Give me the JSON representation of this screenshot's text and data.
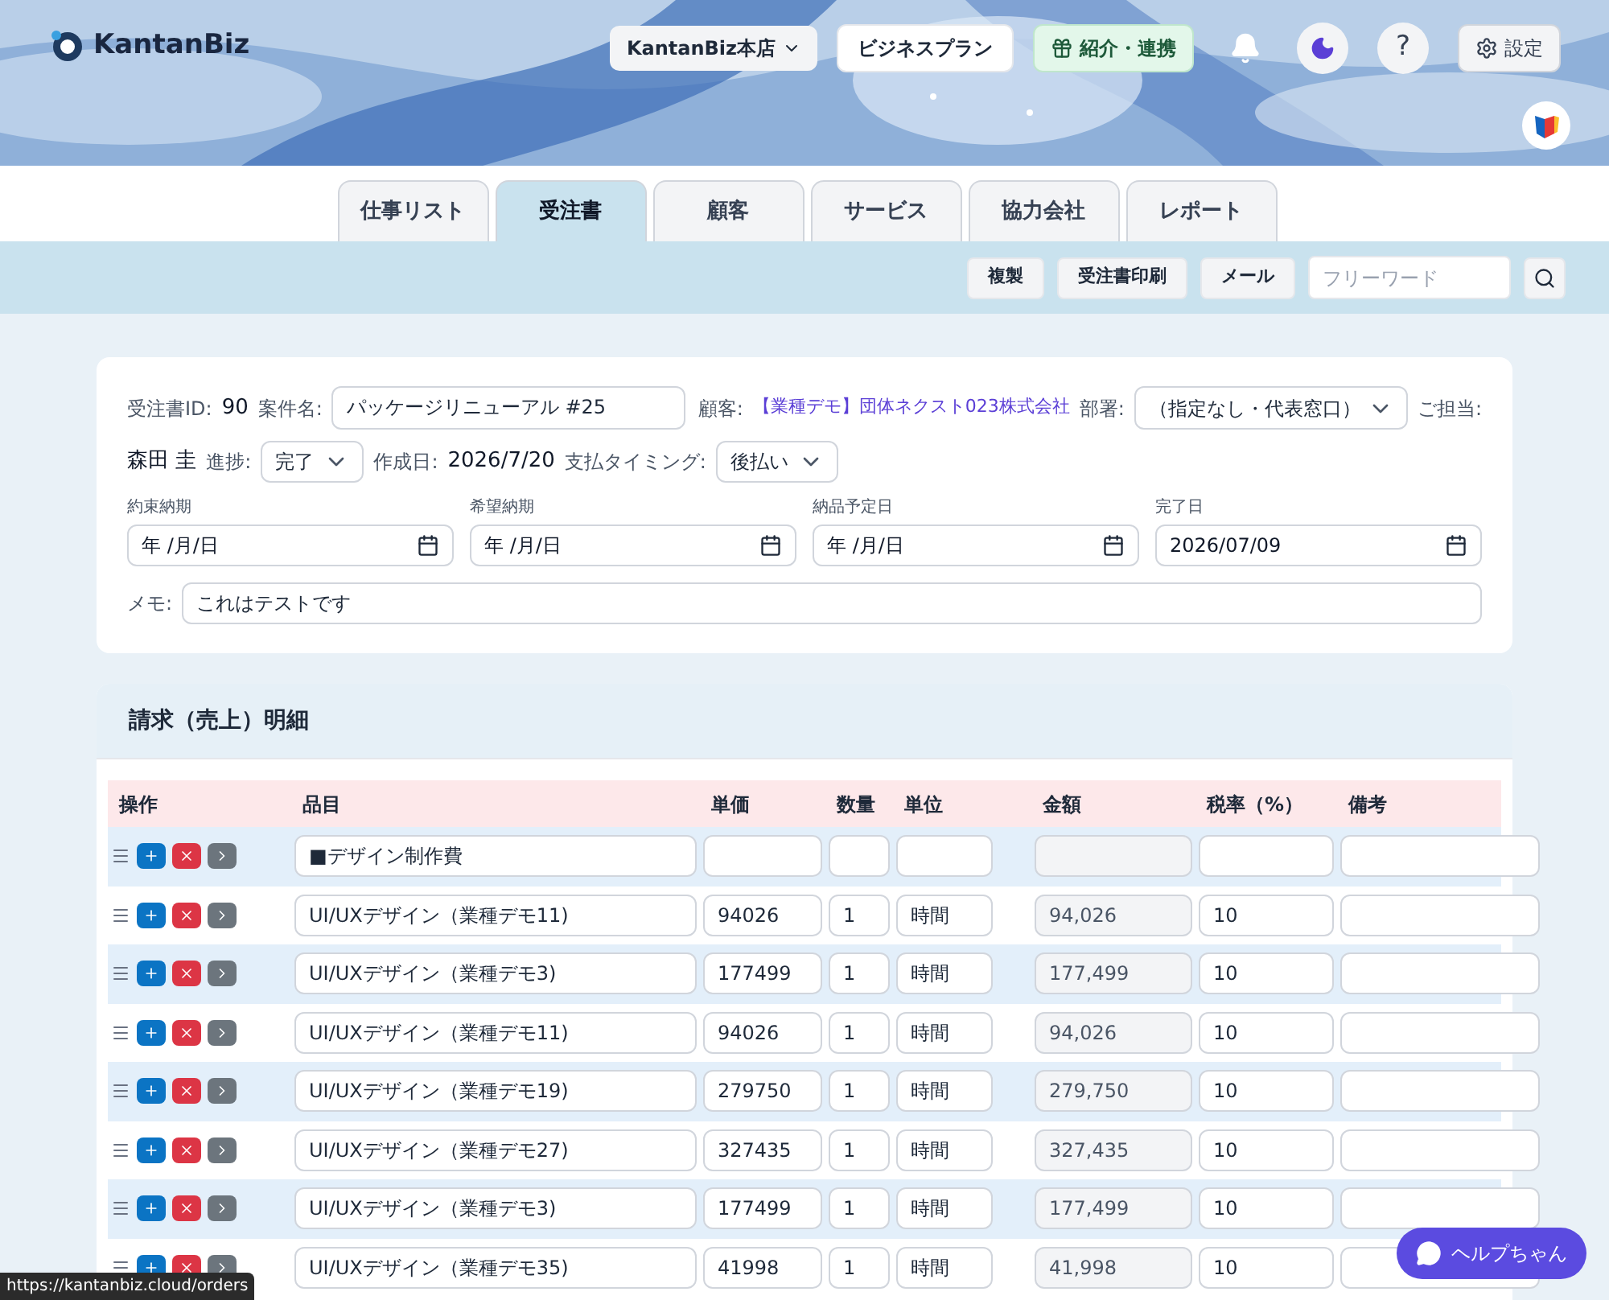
{
  "header": {
    "logo": "KantanBiz",
    "store": "KantanBiz本店",
    "plan": "ビジネスプラン",
    "referral": "紹介・連携",
    "help": "?",
    "settings": "設定"
  },
  "tabs": [
    {
      "label": "仕事リスト",
      "selected": false
    },
    {
      "label": "受注書",
      "selected": true
    },
    {
      "label": "顧客",
      "selected": false
    },
    {
      "label": "サービス",
      "selected": false
    },
    {
      "label": "協力会社",
      "selected": false
    },
    {
      "label": "レポート",
      "selected": false
    }
  ],
  "toolbar": {
    "buttons": [
      "複製",
      "受注書印刷",
      "メール"
    ],
    "search": {
      "placeholder": "フリーワード"
    }
  },
  "order": {
    "id_label": "受注書ID:",
    "id": "90",
    "case_label": "案件名:",
    "case": "パッケージリニューアル #25",
    "customer_label": "顧客:",
    "customer": "【業種デモ】団体ネクスト023株式会社",
    "dept_label": "部署:",
    "dept": "（指定なし・代表窓口）",
    "staff_label": "ご担当:",
    "staff": "森田 圭",
    "progress_label": "進捗:",
    "progress": "完了",
    "created_label": "作成日:",
    "created": "2026/7/20",
    "pay_label": "支払タイミング:",
    "pay": "後払い",
    "dates": [
      {
        "label": "約束納期",
        "value": "年 /月/日"
      },
      {
        "label": "希望納期",
        "value": "年 /月/日"
      },
      {
        "label": "納品予定日",
        "value": "年 /月/日"
      },
      {
        "label": "完了日",
        "value": "2026/07/09"
      }
    ],
    "memo_label": "メモ:",
    "memo": "これはテストです"
  },
  "details": {
    "title": "請求（売上）明細",
    "columns": [
      "操作",
      "品目",
      "単価",
      "数量",
      "単位",
      "金額",
      "税率（%）",
      "備考"
    ],
    "rows": [
      {
        "kind": "heading",
        "item": "■デザイン制作費"
      },
      {
        "kind": "item",
        "item": "UI/UXデザイン（業種デモ11)",
        "price": "94026",
        "qty": "1",
        "unit": "時間",
        "amount": "94,026",
        "tax": "10"
      },
      {
        "kind": "item",
        "item": "UI/UXデザイン（業種デモ3)",
        "price": "177499",
        "qty": "1",
        "unit": "時間",
        "amount": "177,499",
        "tax": "10"
      },
      {
        "kind": "item",
        "item": "UI/UXデザイン（業種デモ11)",
        "price": "94026",
        "qty": "1",
        "unit": "時間",
        "amount": "94,026",
        "tax": "10"
      },
      {
        "kind": "item",
        "item": "UI/UXデザイン（業種デモ19)",
        "price": "279750",
        "qty": "1",
        "unit": "時間",
        "amount": "279,750",
        "tax": "10"
      },
      {
        "kind": "item",
        "item": "UI/UXデザイン（業種デモ27)",
        "price": "327435",
        "qty": "1",
        "unit": "時間",
        "amount": "327,435",
        "tax": "10"
      },
      {
        "kind": "item",
        "item": "UI/UXデザイン（業種デモ3)",
        "price": "177499",
        "qty": "1",
        "unit": "時間",
        "amount": "177,499",
        "tax": "10"
      },
      {
        "kind": "item",
        "item": "UI/UXデザイン（業種デモ35)",
        "price": "41998",
        "qty": "1",
        "unit": "時間",
        "amount": "41,998",
        "tax": "10"
      }
    ]
  },
  "help_chat": "ヘルプちゃん",
  "status_url": "https://kantanbiz.cloud/orders"
}
